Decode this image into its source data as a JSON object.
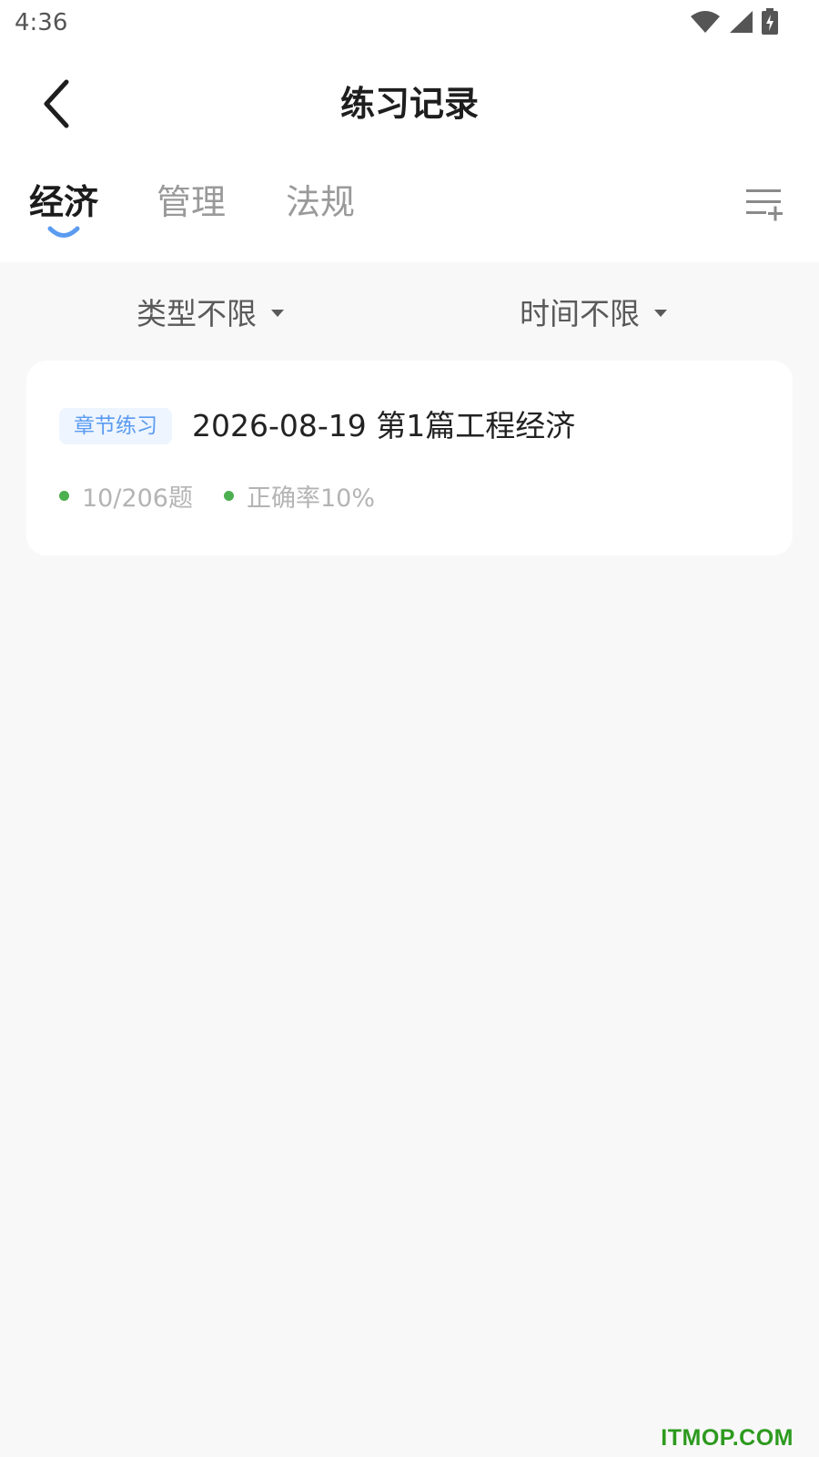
{
  "status_bar": {
    "time": "4:36",
    "icons": [
      "wifi-icon",
      "signal-icon",
      "battery-charging-icon"
    ]
  },
  "header": {
    "title": "练习记录",
    "back_icon": "chevron-left-icon"
  },
  "tabs": [
    {
      "label": "经济",
      "active": true
    },
    {
      "label": "管理",
      "active": false
    },
    {
      "label": "法规",
      "active": false
    }
  ],
  "tab_menu_icon": "list-add-icon",
  "filters": {
    "type": "类型不限",
    "time": "时间不限"
  },
  "records": [
    {
      "tag": "章节练习",
      "title": "2026-08-19 第1篇工程经济",
      "progress": "10/206题",
      "accuracy": "正确率10%"
    }
  ],
  "watermark": "ITMOP.COM",
  "colors": {
    "accent": "#5b9bf0",
    "status_dot": "#4caf50",
    "watermark": "#2d9a1e",
    "background": "#f8f8f8"
  }
}
